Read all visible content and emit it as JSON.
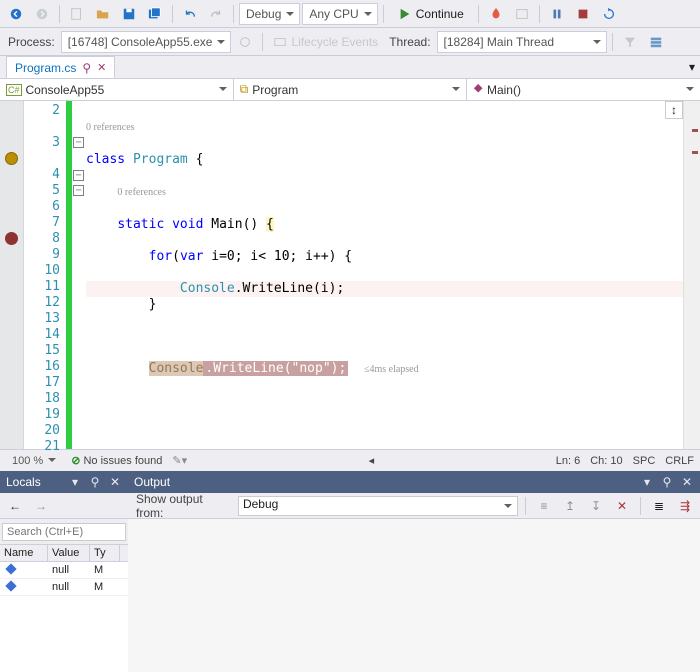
{
  "toolbar": {
    "config": "Debug",
    "platform": "Any CPU",
    "continue": "Continue"
  },
  "process": {
    "label": "Process:",
    "value": "[16748] ConsoleApp55.exe"
  },
  "lifecycle": "Lifecycle Events",
  "thread": {
    "label": "Thread:",
    "value": "[18284] Main Thread"
  },
  "tab": "Program.cs",
  "crumbs": {
    "project": "ConsoleApp55",
    "class": "Program",
    "method": "Main()"
  },
  "refs": "0 references",
  "code": {
    "l3": {
      "kw": "class",
      "name": "Program",
      "brace": " {"
    },
    "l4": {
      "kw1": "static",
      "kw2": "void",
      "name": "Main",
      "rest": "() ",
      "brace": "{"
    },
    "l5": {
      "kw1": "for",
      "p1": "(",
      "kw2": "var",
      "rest": " i=0; i< 10; i++) {"
    },
    "l6": {
      "cls": "Console",
      "rest": ".WriteLine(i);"
    },
    "l7": "        }",
    "l9": {
      "a": "Console",
      "b": ".WriteLine(",
      "c": "\"nop\"",
      "d": ");"
    },
    "perf": "≤4ms elapsed"
  },
  "lines": [
    2,
    3,
    4,
    5,
    6,
    7,
    8,
    9,
    10,
    11,
    12,
    13,
    14,
    15,
    16,
    17,
    18,
    19,
    20,
    21
  ],
  "status": {
    "zoom": "100 %",
    "issues": "No issues found",
    "ln": "Ln: 6",
    "ch": "Ch: 10",
    "spc": "SPC",
    "crlf": "CRLF"
  },
  "locals": {
    "title": "Locals",
    "search": "Search (Ctrl+E)",
    "cols": {
      "name": "Name",
      "value": "Value",
      "type": "Ty"
    },
    "rows": [
      {
        "name": "",
        "value": "null",
        "type": "M"
      },
      {
        "name": "",
        "value": "null",
        "type": "M"
      }
    ]
  },
  "output": {
    "title": "Output",
    "from": "Show output from:",
    "src": "Debug"
  }
}
